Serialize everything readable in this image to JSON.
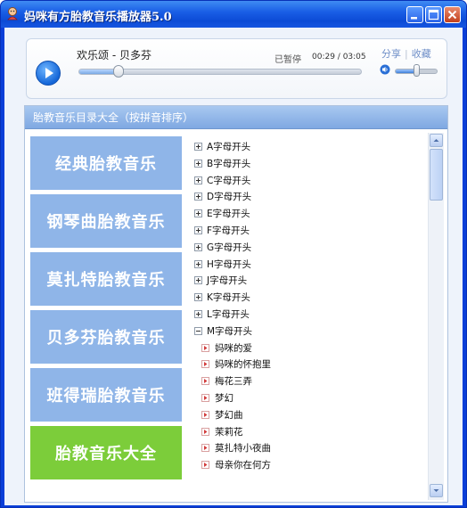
{
  "window": {
    "title": "妈咪有方胎教音乐播放器5.0"
  },
  "player": {
    "song_title": "欢乐颂 - 贝多芬",
    "state": "已暂停",
    "time": "00:29 / 03:05",
    "progress_fraction": 0.14,
    "volume_fraction": 0.5,
    "share_label": "分享",
    "favorite_label": "收藏"
  },
  "catalog": {
    "header": "胎教音乐目录大全（按拼音排序）",
    "categories": [
      {
        "label": "经典胎教音乐",
        "active": false
      },
      {
        "label": "钢琴曲胎教音乐",
        "active": false
      },
      {
        "label": "莫扎特胎教音乐",
        "active": false
      },
      {
        "label": "贝多芬胎教音乐",
        "active": false
      },
      {
        "label": "班得瑞胎教音乐",
        "active": false
      },
      {
        "label": "胎教音乐大全",
        "active": true
      }
    ],
    "tree": [
      {
        "label": "A字母开头",
        "expanded": false
      },
      {
        "label": "B字母开头",
        "expanded": false
      },
      {
        "label": "C字母开头",
        "expanded": false
      },
      {
        "label": "D字母开头",
        "expanded": false
      },
      {
        "label": "E字母开头",
        "expanded": false
      },
      {
        "label": "F字母开头",
        "expanded": false
      },
      {
        "label": "G字母开头",
        "expanded": false
      },
      {
        "label": "H字母开头",
        "expanded": false
      },
      {
        "label": "J字母开头",
        "expanded": false
      },
      {
        "label": "K字母开头",
        "expanded": false
      },
      {
        "label": "L字母开头",
        "expanded": false
      },
      {
        "label": "M字母开头",
        "expanded": true,
        "children": [
          "妈咪的爱",
          "妈咪的怀抱里",
          "梅花三弄",
          "梦幻",
          "梦幻曲",
          "茉莉花",
          "莫扎特小夜曲",
          "母亲你在何方"
        ]
      }
    ]
  },
  "colors": {
    "accent_blue": "#8fb5e8",
    "active_green": "#7ccd3a",
    "titlebar_blue": "#0c4bd6"
  },
  "icons": {
    "app": "baby-icon",
    "play": "play-icon",
    "volume": "speaker-icon",
    "expand": "plus-box-icon",
    "collapse": "minus-box-icon",
    "track": "music-note-icon"
  }
}
